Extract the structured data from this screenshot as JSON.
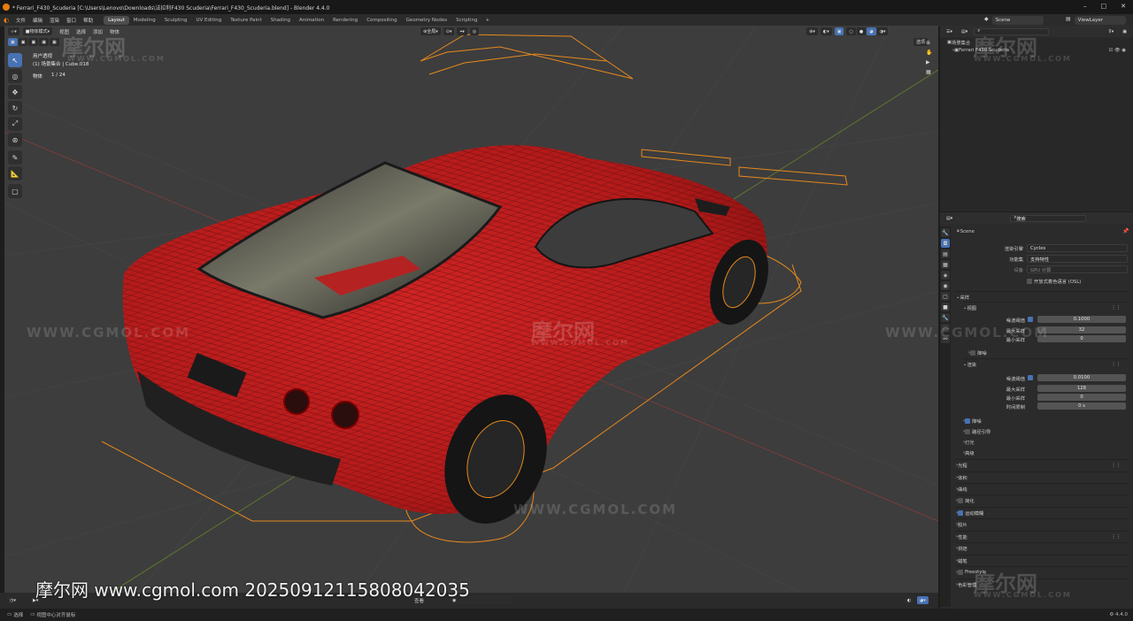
{
  "window": {
    "title": "* Ferrari_F430_Scuderia [C:\\Users\\Lenovo\\Downloads\\法拉利F430 Scuderia\\Ferrari_F430_Scuderia.blend] - Blender 4.4.0",
    "minimize": "–",
    "maximize": "□",
    "close": "✕"
  },
  "menubar": {
    "menus": [
      "文件",
      "编辑",
      "渲染",
      "窗口",
      "帮助"
    ],
    "workspaces": [
      "Layout",
      "Modeling",
      "Sculpting",
      "UV Editing",
      "Texture Paint",
      "Shading",
      "Animation",
      "Rendering",
      "Compositing",
      "Geometry Nodes",
      "Scripting"
    ],
    "active_workspace": "Layout",
    "add_tab": "+",
    "scene": "Scene",
    "view_layer": "ViewLayer"
  },
  "viewport_header": {
    "mode": "物体模式",
    "menus": [
      "视图",
      "选择",
      "添加",
      "物体"
    ],
    "transform": "全局",
    "options": "选项"
  },
  "viewport_overlay": {
    "view_name": "用户透视",
    "collection": "(1) 场景集合 | Cube.018",
    "objects_label": "物体",
    "objects_count": "1 / 24"
  },
  "toolbar": {
    "tools": [
      "select-box",
      "cursor",
      "move",
      "rotate",
      "scale",
      "transform",
      "annotate",
      "measure",
      "add-cube"
    ],
    "active": "select-box"
  },
  "outliner": {
    "search_placeholder": "",
    "root": "场景集合",
    "items": [
      "Ferrari F430 Scuderia"
    ]
  },
  "properties": {
    "search_placeholder": "搜索",
    "scene": "Scene",
    "render_engine_label": "渲染引擎",
    "render_engine": "Cycles",
    "feature_set_label": "功能集",
    "feature_set": "支持特性",
    "device_label": "设备",
    "device": "GPU 计算",
    "osl_label": "开放式着色语言 (OSL)",
    "sampling": "采样",
    "viewport_section": "视图",
    "viewport_noise_label": "噪波阈值",
    "viewport_noise": "0.1000",
    "viewport_max_label": "最大采样",
    "viewport_max": "32",
    "viewport_min_label": "最小采样",
    "viewport_min": "0",
    "denoise_section": "降噪",
    "render_section": "渲染",
    "render_noise_label": "噪波阈值",
    "render_noise": "0.0100",
    "render_max_label": "最大采样",
    "render_max": "128",
    "render_min_label": "最小采样",
    "render_min": "0",
    "time_limit_label": "时间限制",
    "time_limit": "0 s",
    "subsections": [
      "降噪",
      "路径引导",
      "灯光",
      "高级"
    ],
    "sections": [
      "光程",
      "体积",
      "曲线",
      "简化",
      "运动模糊",
      "胶片",
      "性能",
      "烘焙",
      "蜡笔",
      "Freestyle",
      "色彩管理"
    ]
  },
  "statusbar": {
    "left_items": [
      "选择",
      "视图中心对齐鼠标"
    ],
    "version": "4.4.0"
  },
  "timeline": {
    "label": "查看"
  },
  "watermark": {
    "text": "摩尔网 www.cgmol.com 20250912115808042035",
    "logo": "摩尔网",
    "site": "WWW.CGMOL.COM"
  },
  "colors": {
    "accent": "#4772b3",
    "selection_outline": "#e8891c",
    "car_red": "#c41e1e",
    "viewport_bg": "#3d3d3d"
  }
}
